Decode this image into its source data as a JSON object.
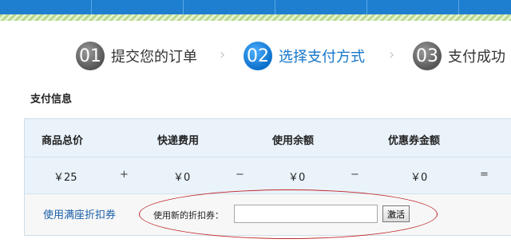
{
  "steps": [
    {
      "num": "01",
      "label": "提交您的订单"
    },
    {
      "num": "02",
      "label": "选择支付方式"
    },
    {
      "num": "03",
      "label": "支付成功"
    }
  ],
  "step_arrow": "›",
  "section_title": "支付信息",
  "table": {
    "headers": [
      "商品总价",
      "快递费用",
      "使用余额",
      "优惠券金额"
    ],
    "values": [
      "￥25",
      "￥0",
      "￥0",
      "￥0"
    ],
    "operators": [
      "+",
      "−",
      "−",
      "="
    ]
  },
  "coupon": {
    "link": "使用满座折扣券",
    "label": "使用新的折扣券：",
    "value": "",
    "button": "激活"
  },
  "colors": {
    "accent": "#1676c9",
    "annotation": "#c0282b"
  }
}
